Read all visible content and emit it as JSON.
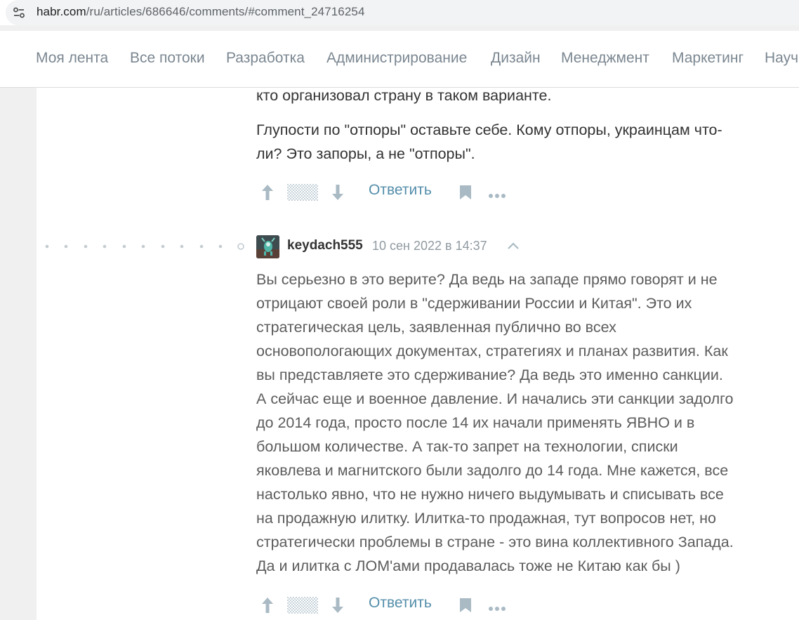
{
  "browser": {
    "url_host": "habr.com",
    "url_path": "/ru/articles/686646/comments/#comment_24716254",
    "site_info_icon": "tune-icon"
  },
  "nav": {
    "items": [
      "Моя лента",
      "Все потоки",
      "Разработка",
      "Администрирование",
      "Дизайн",
      "Менеджмент",
      "Маркетинг",
      "Науч"
    ]
  },
  "comment1": {
    "line_prev": "кто организовал страну в таком варианте.",
    "para_lines": [
      "Глупости по \"отпоры\" оставьте себе. Кому отпоры, украинцам что-",
      "ли? Это запоры, а не \"отпоры\"."
    ],
    "reply_label": "Ответить"
  },
  "comment2": {
    "author": "keydach555",
    "date": "10 сен 2022 в 14:37",
    "lines": [
      "Вы серьезно в это верите? Да ведь на западе прямо говорят и не",
      "отрицают своей роли в \"сдерживании России и Китая\". Это их",
      "стратегическая цель, заявленная публично во всех",
      "основопологающих документах, стратегиях и планах развития. Как",
      "вы представляете это сдерживание? Да ведь это именно санкции.",
      "А сейчас еще и военное давление. И начались эти санкции задолго",
      "до 2014 года, просто после 14 их начали применять ЯВНО и в",
      "большом количестве. А так-то запрет на технологии, списки",
      "яковлева и магнитского были задолго до 14 года. Мне кажется, все",
      "настолько явно, что не нужно ничего выдумывать и списывать все",
      "на продажную илитку. Илитка-то продажная, тут вопросов нет, но",
      "стратегически проблемы в стране - это вина коллективного Запада.",
      "Да и илитка с ЛОМ'ами продавалась тоже не Китаю как бы )"
    ],
    "reply_label": "Ответить"
  },
  "colors": {
    "link": "#548eaa",
    "icon": "#a9bac4",
    "nav_text": "#7b8791"
  }
}
